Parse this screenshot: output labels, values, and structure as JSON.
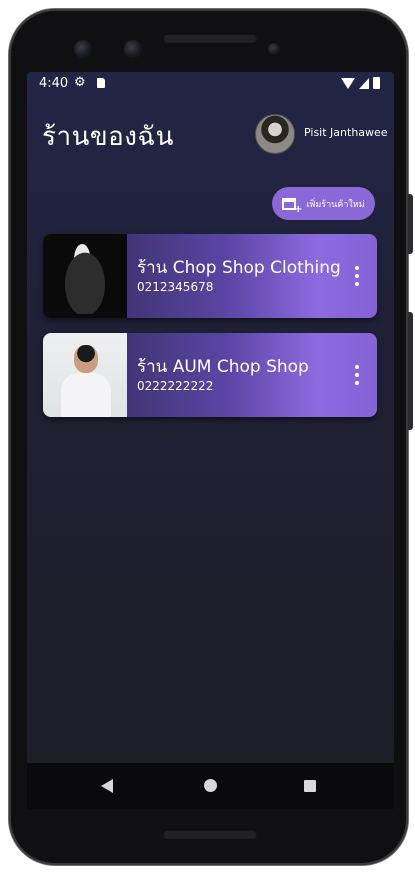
{
  "status_bar": {
    "time": "4:40"
  },
  "header": {
    "title": "ร้านของฉัน",
    "user_name": "Pisit Janthawee"
  },
  "actions": {
    "add_store_label": "เพิ่มร้านค้าใหม่"
  },
  "stores": [
    {
      "name": "ร้าน Chop Shop Clothing",
      "phone": "0212345678"
    },
    {
      "name": "ร้าน AUM Chop Shop",
      "phone": "0222222222"
    }
  ],
  "colors": {
    "accent": "#8a68d8",
    "background": "#1f2034",
    "card_gradient_end": "#8d6ae0"
  },
  "icons": {
    "status": [
      "gear-icon",
      "sd-card-icon",
      "wifi-icon",
      "signal-icon",
      "battery-icon"
    ],
    "add_store": "add-store-icon",
    "card_menu": "more-vert-icon",
    "nav": [
      "back-icon",
      "home-icon",
      "recents-icon"
    ]
  }
}
